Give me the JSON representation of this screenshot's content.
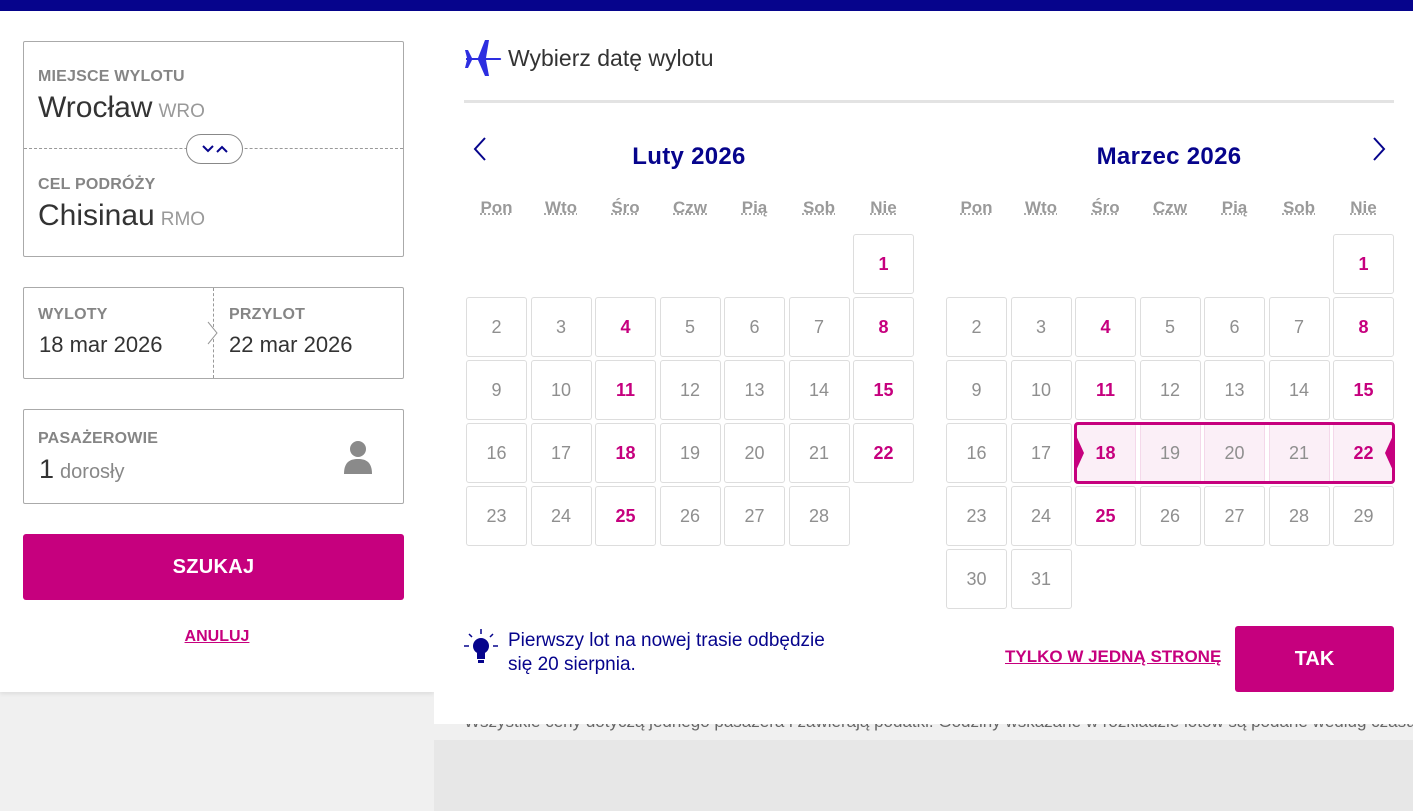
{
  "search_form": {
    "origin_label": "MIEJSCE WYLOTU",
    "origin_city": "Wrocław",
    "origin_code": "WRO",
    "destination_label": "CEL PODRÓŻY",
    "destination_city": "Chisinau",
    "destination_code": "RMO",
    "departure_label": "WYLOTY",
    "departure_value": "18 mar 2026",
    "return_label": "PRZYLOT",
    "return_value": "22 mar 2026",
    "passengers_label": "PASAŻEROWIE",
    "passengers_count": "1",
    "passengers_unit": "dorosły",
    "search_button": "SZUKAJ",
    "cancel_link": "ANULUJ"
  },
  "calendar": {
    "title": "Wybierz datę wylotu",
    "weekdays": [
      "Pon",
      "Wto",
      "Śro",
      "Czw",
      "Pią",
      "Sob",
      "Nie"
    ],
    "months": [
      {
        "title": "Luty 2026",
        "first_weekday": 6,
        "days": [
          {
            "n": "1",
            "available": true
          },
          {
            "n": "2",
            "available": false
          },
          {
            "n": "3",
            "available": false
          },
          {
            "n": "4",
            "available": true
          },
          {
            "n": "5",
            "available": false
          },
          {
            "n": "6",
            "available": false
          },
          {
            "n": "7",
            "available": false
          },
          {
            "n": "8",
            "available": true
          },
          {
            "n": "9",
            "available": false
          },
          {
            "n": "10",
            "available": false
          },
          {
            "n": "11",
            "available": true
          },
          {
            "n": "12",
            "available": false
          },
          {
            "n": "13",
            "available": false
          },
          {
            "n": "14",
            "available": false
          },
          {
            "n": "15",
            "available": true
          },
          {
            "n": "16",
            "available": false
          },
          {
            "n": "17",
            "available": false
          },
          {
            "n": "18",
            "available": true
          },
          {
            "n": "19",
            "available": false
          },
          {
            "n": "20",
            "available": false
          },
          {
            "n": "21",
            "available": false
          },
          {
            "n": "22",
            "available": true
          },
          {
            "n": "23",
            "available": false
          },
          {
            "n": "24",
            "available": false
          },
          {
            "n": "25",
            "available": true
          },
          {
            "n": "26",
            "available": false
          },
          {
            "n": "27",
            "available": false
          },
          {
            "n": "28",
            "available": false
          }
        ]
      },
      {
        "title": "Marzec 2026",
        "first_weekday": 6,
        "selected_range": [
          "18",
          "22"
        ],
        "days": [
          {
            "n": "1",
            "available": true
          },
          {
            "n": "2",
            "available": false
          },
          {
            "n": "3",
            "available": false
          },
          {
            "n": "4",
            "available": true
          },
          {
            "n": "5",
            "available": false
          },
          {
            "n": "6",
            "available": false
          },
          {
            "n": "7",
            "available": false
          },
          {
            "n": "8",
            "available": true
          },
          {
            "n": "9",
            "available": false
          },
          {
            "n": "10",
            "available": false
          },
          {
            "n": "11",
            "available": true
          },
          {
            "n": "12",
            "available": false
          },
          {
            "n": "13",
            "available": false
          },
          {
            "n": "14",
            "available": false
          },
          {
            "n": "15",
            "available": true
          },
          {
            "n": "16",
            "available": false
          },
          {
            "n": "17",
            "available": false
          },
          {
            "n": "18",
            "available": true
          },
          {
            "n": "19",
            "available": false
          },
          {
            "n": "20",
            "available": false
          },
          {
            "n": "21",
            "available": false
          },
          {
            "n": "22",
            "available": true
          },
          {
            "n": "23",
            "available": false
          },
          {
            "n": "24",
            "available": false
          },
          {
            "n": "25",
            "available": true
          },
          {
            "n": "26",
            "available": false
          },
          {
            "n": "27",
            "available": false
          },
          {
            "n": "28",
            "available": false
          },
          {
            "n": "29",
            "available": false
          },
          {
            "n": "30",
            "available": false
          },
          {
            "n": "31",
            "available": false
          }
        ]
      }
    ],
    "tip_text": "Pierwszy lot na nowej trasie odbędzie się 20 sierpnia.",
    "one_way_link": "TYLKO W JEDNĄ STRONĘ",
    "confirm_button": "TAK"
  },
  "background": {
    "notice_text": "Wszystkie ceny dotyczą jednego pasażera i zawierają podatki. Godziny wskazane w rozkładzie lotów są podane według czasu ob"
  },
  "colors": {
    "brand_blue": "#06048c",
    "brand_magenta": "#c6007e"
  },
  "icons": [
    "plane-icon",
    "swap-icon",
    "chevron-right-icon",
    "user-icon",
    "chevron-left-icon",
    "lightbulb-icon"
  ]
}
